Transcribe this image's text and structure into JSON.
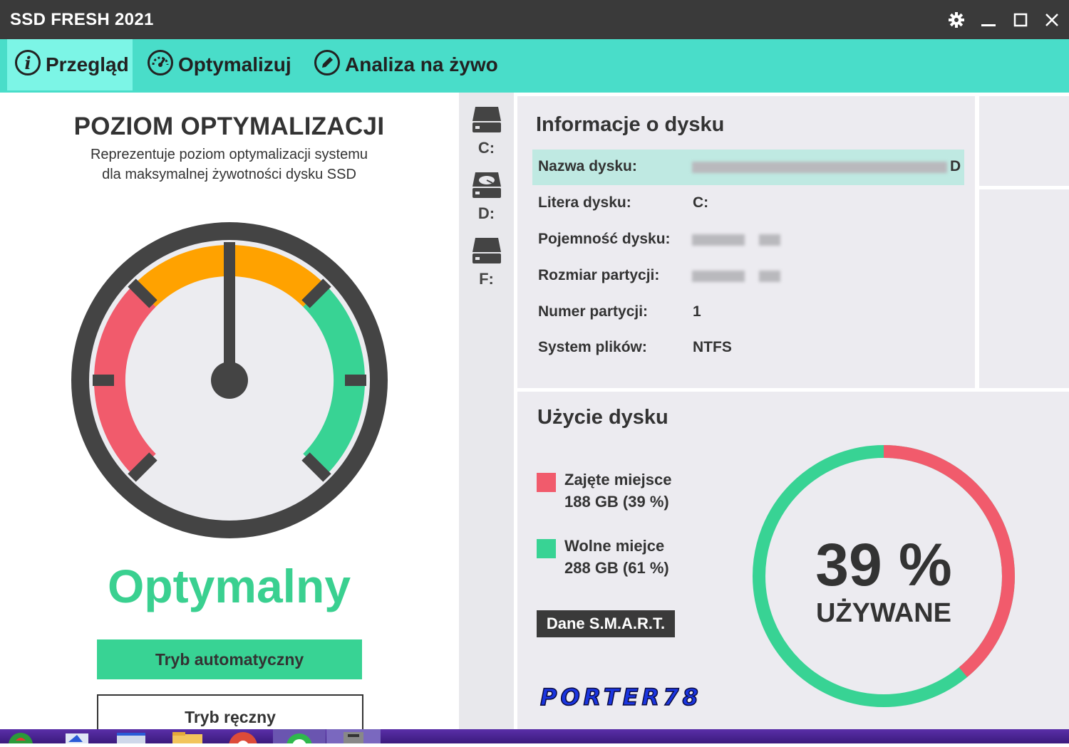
{
  "app": {
    "title": "SSD FRESH 2021"
  },
  "nav": {
    "tabs": [
      {
        "label": "Przegląd",
        "icon": "info-icon",
        "active": true
      },
      {
        "label": "Optymalizuj",
        "icon": "speedometer-icon",
        "active": false
      },
      {
        "label": "Analiza na żywo",
        "icon": "pencil-icon",
        "active": false
      }
    ]
  },
  "overview": {
    "title": "POZIOM OPTYMALIZACJI",
    "description": "Reprezentuje poziom optymalizacji systemu dla maksymalnej żywotności dysku SSD",
    "status": "Optymalny",
    "gauge_level": "optimal",
    "auto_button": "Tryb automatyczny",
    "manual_button": "Tryb ręczny"
  },
  "drives": [
    {
      "letter": "C:",
      "icon": "ssd-drive-icon",
      "selected": true
    },
    {
      "letter": "D:",
      "icon": "hdd-drive-icon",
      "selected": false
    },
    {
      "letter": "F:",
      "icon": "ssd-drive-icon",
      "selected": false
    }
  ],
  "disk_info": {
    "title": "Informacje o dysku",
    "rows": [
      {
        "key": "Nazwa dysku:",
        "value": "D",
        "redacted": true
      },
      {
        "key": "Litera dysku:",
        "value": "C:"
      },
      {
        "key": "Pojemność dysku:",
        "value": "",
        "redacted": true
      },
      {
        "key": "Rozmiar partycji:",
        "value": "",
        "redacted": true
      },
      {
        "key": "Numer partycji:",
        "value": "1"
      },
      {
        "key": "System plików:",
        "value": "NTFS"
      }
    ]
  },
  "usage": {
    "title": "Użycie dysku",
    "used_label": "Zajęte miejsce",
    "used_value": "188 GB (39 %)",
    "free_label": "Wolne miejce",
    "free_value": "288 GB (61 %)",
    "smart_button": "Dane S.M.A.R.T.",
    "percent_text": "39 %",
    "percent_label": "UŻYWANE",
    "used_fraction": 0.39,
    "colors": {
      "used": "#f15b6c",
      "free": "#38d394"
    }
  },
  "watermark": "PORTER78",
  "colors": {
    "titlebar": "#3a3a3a",
    "nav": "#49ddc9",
    "nav_active": "#7cf5e6",
    "accent_green": "#38d394",
    "accent_red": "#f15b6c",
    "accent_orange": "#ffa200"
  }
}
